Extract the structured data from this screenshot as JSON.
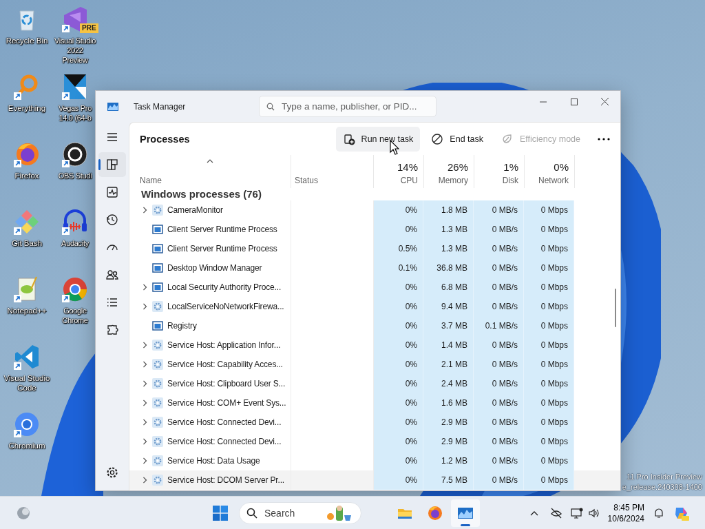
{
  "desktop": {
    "icons": [
      {
        "label": "Recycle Bin",
        "kind": "recycle-bin",
        "shortcut": false
      },
      {
        "label": "Everything",
        "kind": "everything",
        "shortcut": true
      },
      {
        "label": "Firefox",
        "kind": "firefox",
        "shortcut": true
      },
      {
        "label": "Git Bash",
        "kind": "git",
        "shortcut": true
      },
      {
        "label": "Notepad++",
        "kind": "notepad",
        "shortcut": true
      },
      {
        "label": "Visual Studio Code",
        "kind": "vscode",
        "shortcut": true
      },
      {
        "label": "Chromium",
        "kind": "chromium",
        "shortcut": true
      },
      {
        "label": "Visual Studio 2022 Preview",
        "kind": "vs-preview",
        "shortcut": true,
        "badge": "PRE"
      },
      {
        "label": "Vegas Pro 14.0 (64-b",
        "kind": "vegas",
        "shortcut": true
      },
      {
        "label": "OBS Studi",
        "kind": "obs",
        "shortcut": true
      },
      {
        "label": "Audacity",
        "kind": "audacity",
        "shortcut": true
      },
      {
        "label": "Google Chrome",
        "kind": "chrome",
        "shortcut": true
      }
    ],
    "watermark": [
      "11 Pro Insider Preview",
      "e_release.240308-1400"
    ]
  },
  "window": {
    "title": "Task Manager",
    "search": {
      "placeholder": "Type a name, publisher, or PID..."
    },
    "nav": [
      {
        "kind": "menu",
        "selected": false
      },
      {
        "kind": "processes",
        "selected": true
      },
      {
        "kind": "performance",
        "selected": false
      },
      {
        "kind": "app-history",
        "selected": false
      },
      {
        "kind": "startup",
        "selected": false
      },
      {
        "kind": "users",
        "selected": false
      },
      {
        "kind": "details",
        "selected": false
      },
      {
        "kind": "services",
        "selected": false
      }
    ],
    "nav_footer": {
      "kind": "settings",
      "selected": false
    },
    "page_title": "Processes",
    "toolbar": [
      {
        "label": "Run new task",
        "kind": "run",
        "disabled": false,
        "hovered": true
      },
      {
        "label": "End task",
        "kind": "end",
        "disabled": false,
        "hovered": false
      },
      {
        "label": "Efficiency mode",
        "kind": "leaf",
        "disabled": true,
        "hovered": false
      }
    ],
    "table": {
      "columns": [
        {
          "label": "Name",
          "sorted": true
        },
        {
          "label": "Status",
          "sorted": false
        },
        {
          "label": "CPU",
          "total": "14%",
          "sorted": false
        },
        {
          "label": "Memory",
          "total": "26%",
          "sorted": false
        },
        {
          "label": "Disk",
          "total": "1%",
          "sorted": false
        },
        {
          "label": "Network",
          "total": "0%",
          "sorted": false
        }
      ],
      "group": "Windows processes (76)",
      "rows": [
        {
          "name": "CameraMonitor",
          "kind": "service",
          "expandable": true,
          "hovered": false,
          "cpu": "0%",
          "memory": "1.8 MB",
          "disk": "0 MB/s",
          "network": "0 Mbps"
        },
        {
          "name": "Client Server Runtime Process",
          "kind": "app",
          "expandable": false,
          "hovered": false,
          "cpu": "0%",
          "memory": "1.3 MB",
          "disk": "0 MB/s",
          "network": "0 Mbps"
        },
        {
          "name": "Client Server Runtime Process",
          "kind": "app",
          "expandable": false,
          "hovered": false,
          "cpu": "0.5%",
          "memory": "1.3 MB",
          "disk": "0 MB/s",
          "network": "0 Mbps"
        },
        {
          "name": "Desktop Window Manager",
          "kind": "app",
          "expandable": false,
          "hovered": false,
          "cpu": "0.1%",
          "memory": "36.8 MB",
          "disk": "0 MB/s",
          "network": "0 Mbps"
        },
        {
          "name": "Local Security Authority Proce...",
          "kind": "app",
          "expandable": true,
          "hovered": false,
          "cpu": "0%",
          "memory": "6.8 MB",
          "disk": "0 MB/s",
          "network": "0 Mbps"
        },
        {
          "name": "LocalServiceNoNetworkFirewa...",
          "kind": "service",
          "expandable": true,
          "hovered": false,
          "cpu": "0%",
          "memory": "9.4 MB",
          "disk": "0 MB/s",
          "network": "0 Mbps"
        },
        {
          "name": "Registry",
          "kind": "app",
          "expandable": false,
          "hovered": false,
          "cpu": "0%",
          "memory": "3.7 MB",
          "disk": "0.1 MB/s",
          "network": "0 Mbps"
        },
        {
          "name": "Service Host: Application Infor...",
          "kind": "service",
          "expandable": true,
          "hovered": false,
          "cpu": "0%",
          "memory": "1.4 MB",
          "disk": "0 MB/s",
          "network": "0 Mbps"
        },
        {
          "name": "Service Host: Capability Acces...",
          "kind": "service",
          "expandable": true,
          "hovered": false,
          "cpu": "0%",
          "memory": "2.1 MB",
          "disk": "0 MB/s",
          "network": "0 Mbps"
        },
        {
          "name": "Service Host: Clipboard User S...",
          "kind": "service",
          "expandable": true,
          "hovered": false,
          "cpu": "0%",
          "memory": "2.4 MB",
          "disk": "0 MB/s",
          "network": "0 Mbps"
        },
        {
          "name": "Service Host: COM+ Event Sys...",
          "kind": "service",
          "expandable": true,
          "hovered": false,
          "cpu": "0%",
          "memory": "1.6 MB",
          "disk": "0 MB/s",
          "network": "0 Mbps"
        },
        {
          "name": "Service Host: Connected Devi...",
          "kind": "service",
          "expandable": true,
          "hovered": false,
          "cpu": "0%",
          "memory": "2.9 MB",
          "disk": "0 MB/s",
          "network": "0 Mbps"
        },
        {
          "name": "Service Host: Connected Devi...",
          "kind": "service",
          "expandable": true,
          "hovered": false,
          "cpu": "0%",
          "memory": "2.9 MB",
          "disk": "0 MB/s",
          "network": "0 Mbps"
        },
        {
          "name": "Service Host: Data Usage",
          "kind": "service",
          "expandable": true,
          "hovered": false,
          "cpu": "0%",
          "memory": "1.2 MB",
          "disk": "0 MB/s",
          "network": "0 Mbps"
        },
        {
          "name": "Service Host: DCOM Server Pr...",
          "kind": "service",
          "expandable": true,
          "hovered": true,
          "cpu": "0%",
          "memory": "7.5 MB",
          "disk": "0 MB/s",
          "network": "0 Mbps"
        }
      ]
    }
  },
  "taskbar": {
    "search": {
      "placeholder": "Search"
    },
    "pinned": [
      {
        "kind": "explorer",
        "selected": false
      },
      {
        "kind": "firefox",
        "selected": false
      },
      {
        "kind": "task-manager",
        "selected": true
      }
    ],
    "time": "8:45 PM",
    "date": "10/6/2024"
  }
}
